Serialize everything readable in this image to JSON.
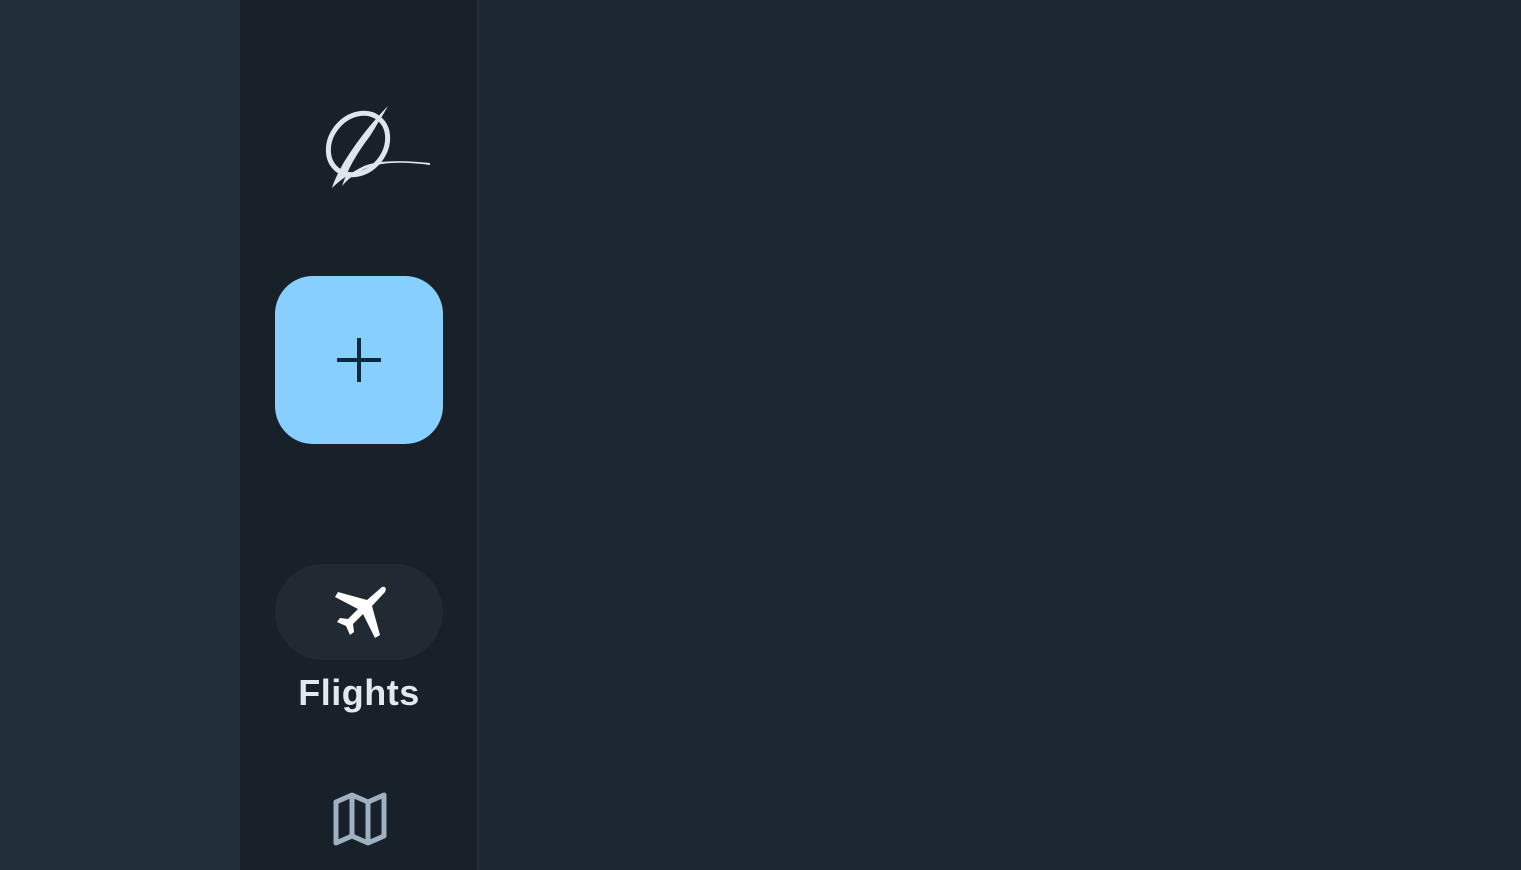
{
  "sidebar": {
    "logo_icon": "boeing-logo-icon",
    "fab": {
      "icon": "plus-icon",
      "background_color": "#86cfff"
    },
    "items": [
      {
        "id": "flights",
        "label": "Flights",
        "icon": "airplane-icon",
        "active": true
      },
      {
        "id": "map",
        "label": "",
        "icon": "map-icon",
        "active": false
      }
    ]
  },
  "colors": {
    "main_background": "#1b2632",
    "rail_background": "#18202a",
    "gutter_background": "#222e3a",
    "accent": "#86cfff",
    "active_pill": "#212a33",
    "label_text": "#e3e8ee",
    "icon_muted": "#9fb0c0"
  }
}
